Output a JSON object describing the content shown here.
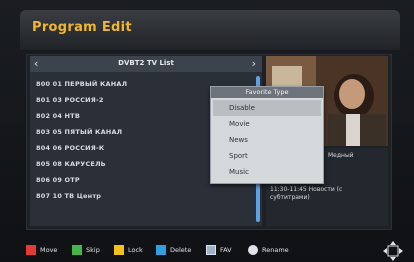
{
  "header": {
    "title": "Program Edit"
  },
  "list": {
    "title": "DVBT2 TV List",
    "channels": [
      "800 01 ПЕРВЫЙ КАНАЛ",
      "801 03 РОССИЯ-2",
      "802 04 НТВ",
      "803 05 ПЯТЫЙ КАНАЛ",
      "804 06 РОССИЯ-К",
      "805 08 КАРУСЕЛЬ",
      "806 09 ОТР",
      "807 10 ТВ Центр"
    ]
  },
  "popup": {
    "title": "Favorite Type",
    "options": [
      "Disable",
      "Movie",
      "News",
      "Sport",
      "Music"
    ],
    "selected": "Disable"
  },
  "epg": {
    "current": "Медный",
    "next_line1": "11:30-11:45  Новости (с",
    "next_line2": "субтитрами)"
  },
  "footer": {
    "move": "Move",
    "skip": "Skip",
    "lock": "Lock",
    "delete": "Delete",
    "fav": "FAV",
    "rename": "Rename"
  },
  "colors": {
    "title": "#f1b72a",
    "red": "#e53935",
    "green": "#43b649",
    "yellow": "#f2c21b",
    "blue": "#2f9fe0",
    "accent_scroll": "#5ea2e6"
  },
  "icons": {
    "fav": "fav-icon",
    "rename": "rename-icon",
    "nav": "navigation-icon"
  }
}
